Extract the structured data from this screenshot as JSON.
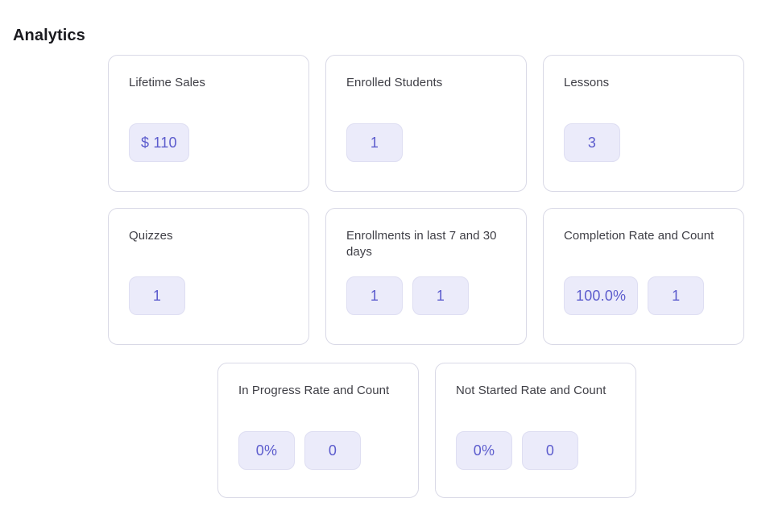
{
  "page": {
    "title": "Analytics",
    "accent_color": "#5c5ccd",
    "badge_bg_color": "#ebebfa",
    "card_border_color": "#d9d9e6",
    "label_color": "#3f3f46"
  },
  "cards": [
    {
      "label": "Lifetime Sales",
      "badges": [
        "$ 110"
      ]
    },
    {
      "label": "Enrolled Students",
      "badges": [
        "1"
      ]
    },
    {
      "label": "Lessons",
      "badges": [
        "3"
      ]
    },
    {
      "label": "Quizzes",
      "badges": [
        "1"
      ]
    },
    {
      "label": "Enrollments in last 7 and 30 days",
      "badges": [
        "1",
        "1"
      ]
    },
    {
      "label": "Completion Rate and Count",
      "badges": [
        "100.0%",
        "1"
      ]
    },
    {
      "label": "In Progress Rate and Count",
      "badges": [
        "0%",
        "0"
      ]
    },
    {
      "label": "Not Started Rate and Count",
      "badges": [
        "0%",
        "0"
      ]
    }
  ]
}
